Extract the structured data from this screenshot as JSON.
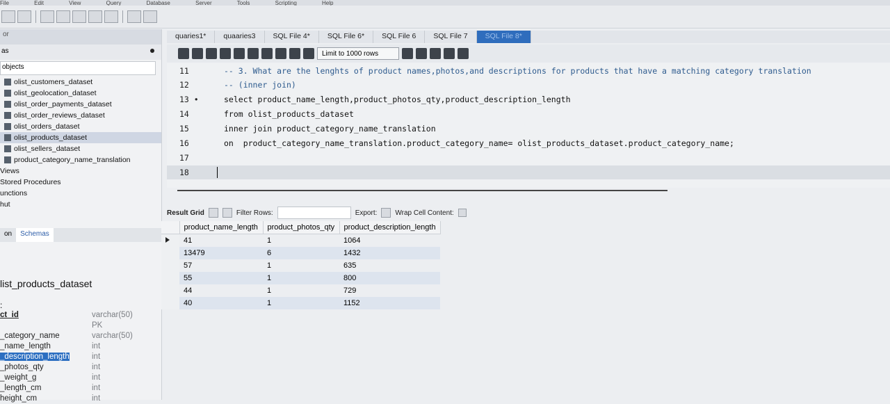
{
  "menubar": [
    "File",
    "Edit",
    "View",
    "Query",
    "Database",
    "Server",
    "Tools",
    "Scripting",
    "Help"
  ],
  "sidebar": {
    "header": "or",
    "subheader": "as",
    "objects_label": "objects",
    "tables": [
      "olist_customers_dataset",
      "olist_geolocation_dataset",
      "olist_order_payments_dataset",
      "olist_order_reviews_dataset",
      "olist_orders_dataset",
      "olist_products_dataset",
      "olist_sellers_dataset",
      "product_category_name_translation"
    ],
    "categories": [
      "Views",
      "Stored Procedures",
      "unctions"
    ],
    "last": "hut",
    "tabs": [
      "on",
      "Schemas"
    ],
    "info_title": "list_products_dataset",
    "info_colon": ":",
    "columns": [
      {
        "name": "ct_id",
        "type": "varchar(50)"
      },
      {
        "name": "",
        "type": "PK"
      },
      {
        "name": "_category_name",
        "type": "varchar(50)"
      },
      {
        "name": "_name_length",
        "type": "int"
      },
      {
        "name": "_description_length",
        "type": "int"
      },
      {
        "name": "_photos_qty",
        "type": "int"
      },
      {
        "name": "_weight_g",
        "type": "int"
      },
      {
        "name": "_length_cm",
        "type": "int"
      },
      {
        "name": "height_cm",
        "type": "int"
      }
    ]
  },
  "tabs": [
    "quaries1*",
    "quaaries3",
    "SQL File 4*",
    "SQL File 6*",
    "SQL File 6",
    "SQL File 7",
    "SQL File 8*"
  ],
  "editor": {
    "limit": "Limit to 1000 rows",
    "lines": [
      {
        "num": "11",
        "text": "-- 3. What are the lenghts of product names,photos,and descriptions for products that have a matching category translation"
      },
      {
        "num": "12",
        "text": "-- (inner join)"
      },
      {
        "num": "13 •",
        "text": "select product_name_length,product_photos_qty,product_description_length"
      },
      {
        "num": "14",
        "text": "from olist_products_dataset"
      },
      {
        "num": "15",
        "text": "inner join product_category_name_translation"
      },
      {
        "num": "16",
        "text": "on  product_category_name_translation.product_category_name= olist_products_dataset.product_category_name;"
      },
      {
        "num": "17",
        "text": ""
      },
      {
        "num": "18",
        "text": ""
      }
    ]
  },
  "result": {
    "toolbar": {
      "result_grid": "Result Grid",
      "filter_rows": "Filter Rows:",
      "export": "Export:",
      "wrap": "Wrap Cell Content:"
    },
    "columns": [
      "product_name_length",
      "product_photos_qty",
      "product_description_length"
    ],
    "rows": [
      [
        "41",
        "1",
        "1064"
      ],
      [
        "13479",
        "6",
        "1432"
      ],
      [
        "57",
        "1",
        "635"
      ],
      [
        "55",
        "1",
        "800"
      ],
      [
        "44",
        "1",
        "729"
      ],
      [
        "40",
        "1",
        "1152"
      ]
    ]
  }
}
